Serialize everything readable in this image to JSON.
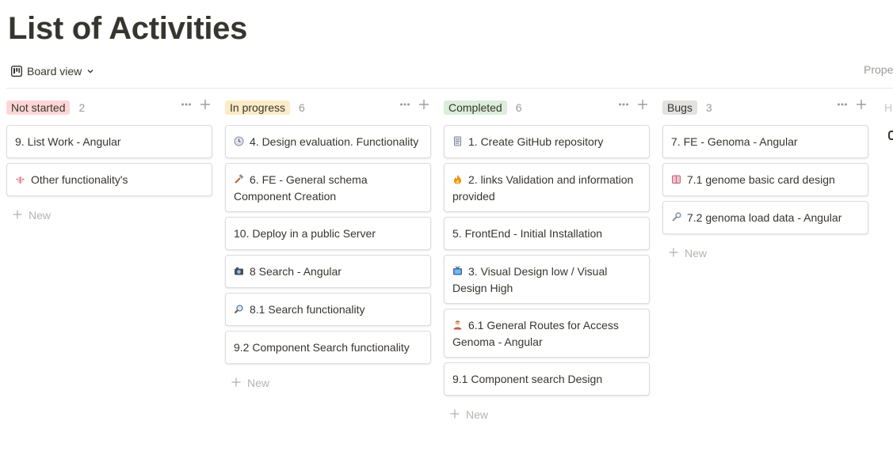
{
  "page": {
    "title": "List of Activities"
  },
  "toolbar": {
    "view_label": "Board view",
    "properties_label": "Prope"
  },
  "hidden_column_initial": "H",
  "new_label": "New",
  "columns": [
    {
      "label": "Not started",
      "count": "2",
      "color": "#ffd6d6",
      "cards": [
        {
          "emoji": "",
          "text": "9. List Work - Angular"
        },
        {
          "emoji": "bug-icon",
          "text": "Other functionality's"
        }
      ]
    },
    {
      "label": "In progress",
      "count": "6",
      "color": "#fdecc8",
      "cards": [
        {
          "emoji": "clock-icon",
          "text": "4. Design evaluation. Functionality"
        },
        {
          "emoji": "hammer-icon",
          "text": "6. FE - General schema Component Creation"
        },
        {
          "emoji": "",
          "text": "10. Deploy in a public Server"
        },
        {
          "emoji": "camera-icon",
          "text": "8 Search - Angular"
        },
        {
          "emoji": "magnifier-icon",
          "text": "8.1 Search functionality"
        },
        {
          "emoji": "",
          "text": "9.2 Component Search functionality"
        }
      ]
    },
    {
      "label": "Completed",
      "count": "6",
      "color": "#dbeddb",
      "cards": [
        {
          "emoji": "document-icon",
          "text": "1. Create GitHub repository"
        },
        {
          "emoji": "fire-icon",
          "text": "2. links Validation and information provided"
        },
        {
          "emoji": "",
          "text": "5. FrontEnd - Initial Installation"
        },
        {
          "emoji": "tv-icon",
          "text": "3. Visual Design low / Visual Design High"
        },
        {
          "emoji": "person-icon",
          "text": "6.1 General Routes for Access Genoma - Angular"
        },
        {
          "emoji": "",
          "text": "9.1 Component search Design"
        }
      ]
    },
    {
      "label": "Bugs",
      "count": "3",
      "color": "#e3e2e0",
      "cards": [
        {
          "emoji": "",
          "text": "7. FE - Genoma - Angular"
        },
        {
          "emoji": "card-icon",
          "text": "7.1 genome basic card design"
        },
        {
          "emoji": "wrench-icon",
          "text": "7.2 genoma load data - Angular"
        }
      ]
    }
  ]
}
